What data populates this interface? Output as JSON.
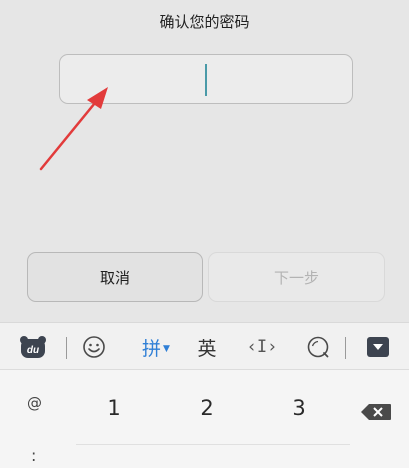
{
  "dialog": {
    "title": "确认您的密码",
    "password_value": "",
    "cancel_label": "取消",
    "next_label": "下一步"
  },
  "keyboard": {
    "toolbar": {
      "logo_text": "du",
      "emoji_icon": "smiley-icon",
      "pinyin_label": "拼",
      "english_label": "英",
      "cursor_label": "‹I›",
      "search_icon": "search-icon",
      "hide_icon": "keyboard-hide-icon"
    },
    "keys": {
      "symbol_at": "@",
      "symbol_colon": ":",
      "key_1": "1",
      "key_2": "2",
      "key_3": "3",
      "backspace_icon": "backspace-icon"
    }
  },
  "colors": {
    "arrow": "#e23b3b",
    "accent": "#2f7fd6",
    "cursor": "#4a9aa8"
  }
}
